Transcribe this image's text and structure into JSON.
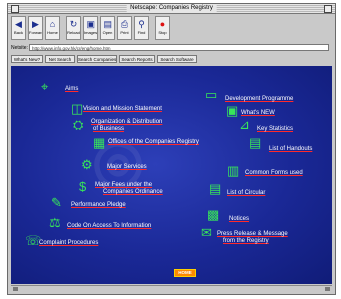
{
  "window": {
    "title": "Netscape: Companies Registry"
  },
  "toolbar": {
    "buttons": [
      {
        "label": "Back",
        "icon": "back-arrow-icon"
      },
      {
        "label": "Forward",
        "icon": "forward-arrow-icon"
      },
      {
        "label": "Home",
        "icon": "home-icon"
      },
      {
        "label": "Reload",
        "icon": "reload-icon"
      },
      {
        "label": "Images",
        "icon": "images-icon"
      },
      {
        "label": "Open",
        "icon": "open-icon"
      },
      {
        "label": "Print",
        "icon": "print-icon"
      },
      {
        "label": "Find",
        "icon": "find-icon"
      },
      {
        "label": "Stop",
        "icon": "stop-icon"
      }
    ]
  },
  "location": {
    "label": "Netsite:",
    "value": "http://www.info.gov.hk/cr/eng/home.htm"
  },
  "directory": {
    "buttons": [
      "What's New?",
      "Net Search",
      "Search Companies",
      "Search Reports",
      "Search Software"
    ]
  },
  "menu": {
    "links": [
      "Aims",
      "Vision and Mission Statement",
      "Organization & Distribution",
      "of Business",
      "Offices of the Companies Registry",
      "Major Services",
      "Major Fees under the",
      "Companies Ordinance",
      "Performance Pledge",
      "Code On Access To Information",
      "Complaint Procedures",
      "Development Programme",
      "What's NEW",
      "Key Statistics",
      "List of Handouts",
      "Common Forms used",
      "List of Circular",
      "Notices",
      "Press Release & Message",
      "from the Registry"
    ],
    "home_button": "HOME"
  },
  "colors": {
    "background": "#1a2896",
    "link_text": "#ffffff",
    "underline": "#ff2a2a",
    "icon": "#37e55a",
    "home": "#ff8a00"
  }
}
